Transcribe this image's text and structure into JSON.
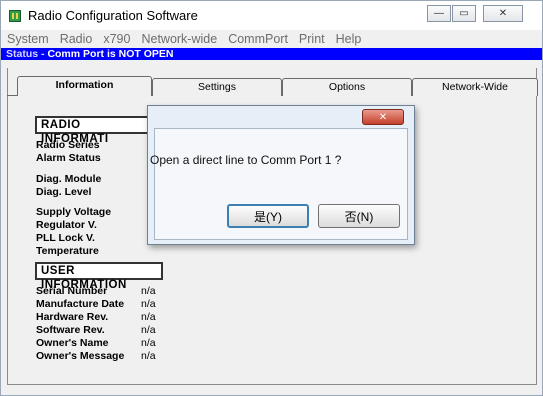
{
  "window": {
    "title": "Radio Configuration Software",
    "controls": {
      "minimize": "—",
      "maximize": "▭",
      "close": "✕"
    }
  },
  "menu": {
    "items": [
      "System",
      "Radio",
      "x790",
      "Network-wide",
      "CommPort",
      "Print",
      "Help"
    ]
  },
  "status": {
    "label": "Status -",
    "text": "Comm Port is NOT OPEN",
    "background": "#0000ff"
  },
  "tabs": [
    {
      "label": "Information",
      "active": true
    },
    {
      "label": "Settings",
      "active": false
    },
    {
      "label": "Options",
      "active": false
    },
    {
      "label": "Network-Wide",
      "active": false
    }
  ],
  "radio_info": {
    "heading": "RADIO INFORMATI",
    "fields": [
      {
        "label": "Radio Series"
      },
      {
        "label": "Alarm Status"
      },
      {
        "label": "Diag. Module"
      },
      {
        "label": "Diag. Level"
      },
      {
        "label": "Supply Voltage"
      },
      {
        "label": "Regulator V."
      },
      {
        "label": "PLL Lock V."
      },
      {
        "label": "Temperature"
      }
    ]
  },
  "user_info": {
    "heading": "USER INFORMATION",
    "fields": [
      {
        "label": "Serial Number",
        "value": "n/a"
      },
      {
        "label": "Manufacture Date",
        "value": "n/a"
      },
      {
        "label": "Hardware Rev.",
        "value": "n/a"
      },
      {
        "label": "Software  Rev.",
        "value": "n/a"
      },
      {
        "label": "Owner's Name",
        "value": "n/a"
      },
      {
        "label": "Owner's Message",
        "value": "n/a"
      }
    ]
  },
  "dialog": {
    "message": "Open a direct line to Comm Port  1 ?",
    "yes_label": "是(Y)",
    "no_label": "否(N)",
    "close": "✕"
  }
}
